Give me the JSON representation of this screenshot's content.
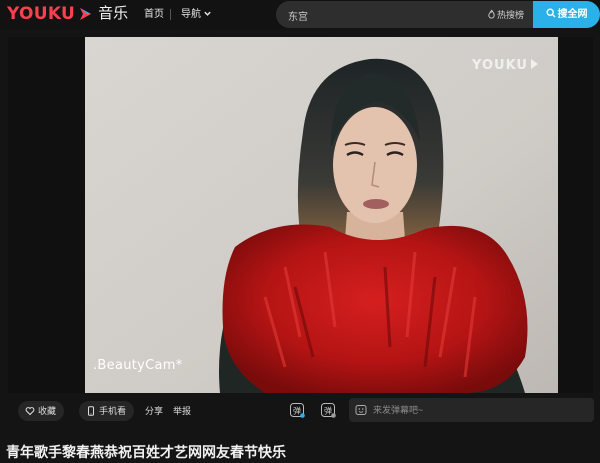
{
  "header": {
    "logo_text": "YOUKU",
    "logo_sub": "音乐",
    "nav": {
      "home": "首页",
      "guide": "导航"
    },
    "search": {
      "value": "东宫",
      "hot_label": "热搜榜",
      "button_label": "搜全网"
    }
  },
  "player": {
    "watermark_top": "YOUKU",
    "watermark_bottom": ".BeautyCam*"
  },
  "controls": {
    "collect_label": "收藏",
    "mobile_label": "手机看",
    "share_label": "分享",
    "report_label": "举报",
    "danmu_placeholder": "来发弹幕吧~"
  },
  "video_title": "青年歌手黎春燕恭祝百姓才艺网网友春节快乐",
  "colors": {
    "brand_red": "#ff3e4e",
    "accent_blue": "#2ab1e9",
    "background": "#141414"
  }
}
